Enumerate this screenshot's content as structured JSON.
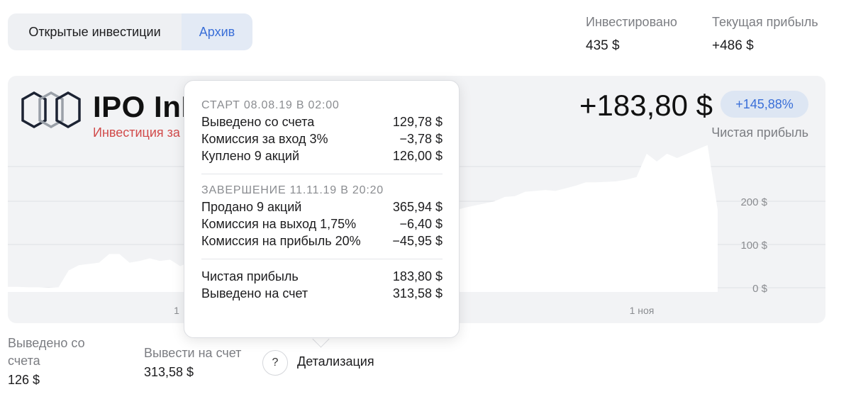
{
  "tabs": {
    "open": "Открытые инвестиции",
    "archive": "Архив"
  },
  "header_stats": {
    "invested_label": "Инвестировано",
    "invested_value": "435 $",
    "current_profit_label": "Текущая прибыль",
    "current_profit_value": "+486 $"
  },
  "card": {
    "company_name": "IPO InN",
    "company_sub": "Инвестиция за",
    "net_profit": "+183,80 $",
    "net_profit_pct": "+145,88%",
    "net_profit_label": "Чистая прибыль",
    "logo_icon": "hexagon-chain-logo",
    "colors": {
      "accent": "#3a6fd8",
      "badge_bg": "#dde6f3",
      "loss": "#d14a4a"
    }
  },
  "chart_data": {
    "type": "area",
    "x_tick_labels": [
      "1",
      "1 ноя"
    ],
    "y_tick_labels": [
      "200 $",
      "100 $",
      "0 $"
    ],
    "ylim": [
      0,
      280
    ],
    "series": [
      {
        "values": [
          2,
          2,
          1,
          1,
          0,
          1,
          40,
          52,
          55,
          58,
          78,
          78,
          58,
          62,
          68,
          62,
          65,
          50,
          60,
          66,
          72,
          70,
          80,
          88,
          95,
          92,
          100,
          108,
          104,
          118,
          122,
          130,
          126,
          140,
          145,
          150,
          156,
          152,
          160,
          155,
          165,
          170,
          175,
          180,
          178,
          185,
          190,
          195,
          200,
          210,
          212,
          222,
          224,
          226,
          224,
          230,
          236,
          244,
          244,
          245,
          246,
          250,
          256,
          310,
          292,
          310,
          300,
          310,
          320,
          330,
          180
        ]
      }
    ]
  },
  "popover": {
    "start_header": "СТАРТ 08.08.19 В 02:00",
    "start_rows": [
      {
        "label": "Выведено со счета",
        "value": "129,78 $"
      },
      {
        "label": "Комиссия за вход 3%",
        "value": "−3,78 $"
      },
      {
        "label": "Куплено 9 акций",
        "value": "126,00 $"
      }
    ],
    "end_header": "ЗАВЕРШЕНИЕ 11.11.19 В 20:20",
    "end_rows": [
      {
        "label": "Продано 9 акций",
        "value": "365,94 $"
      },
      {
        "label": "Комиссия на выход 1,75%",
        "value": "−6,40 $"
      },
      {
        "label": "Комиссия на прибыль 20%",
        "value": "−45,95 $"
      }
    ],
    "summary_rows": [
      {
        "label": "Чистая прибыль",
        "value": "183,80 $"
      },
      {
        "label": "Выведено на счет",
        "value": "313,58 $"
      }
    ]
  },
  "footer": {
    "withdrawn_label": "Выведено со счета",
    "withdrawn_value": "126 $",
    "withdraw_label": "Вывести на счет",
    "withdraw_value": "313,58 $",
    "help_icon": "question-mark-icon",
    "help_glyph": "?",
    "detail_link": "Детализация"
  }
}
